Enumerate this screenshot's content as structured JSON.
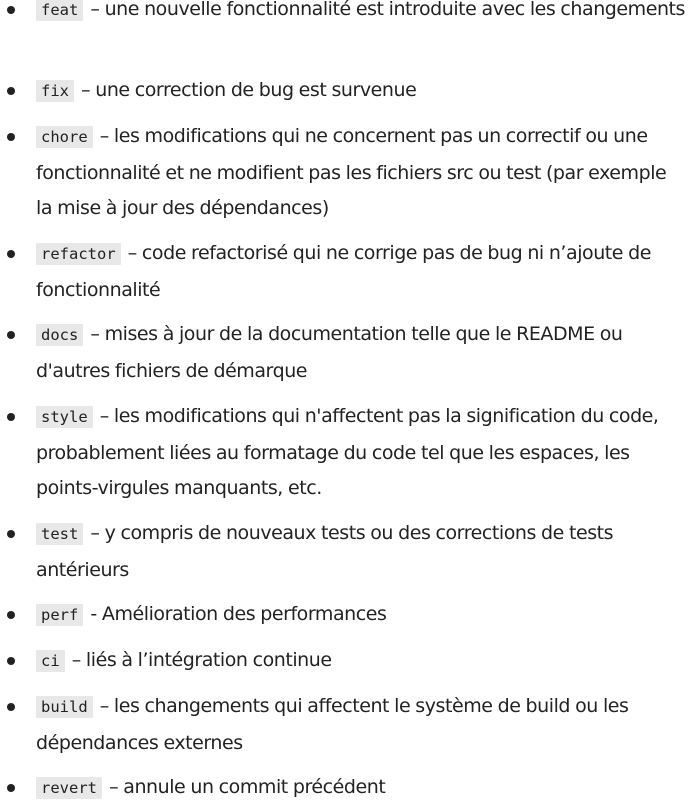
{
  "items": [
    {
      "type": "feat",
      "separator": "–",
      "description": "une nouvelle fonctionnalité est introduite avec les changements"
    },
    {
      "type": "fix",
      "separator": "–",
      "description": "une correction de bug est survenue"
    },
    {
      "type": "chore",
      "separator": "–",
      "description": "les modifications qui ne concernent pas un correctif ou une fonctionnalité et ne modifient pas les fichiers src ou test (par exemple la mise à jour des dépendances)"
    },
    {
      "type": "refactor",
      "separator": "–",
      "description": "code refactorisé qui ne corrige pas de bug ni n’ajoute de fonctionnalité"
    },
    {
      "type": "docs",
      "separator": "–",
      "description": "mises à jour de la documentation telle que le README ou d'autres fichiers de démarque"
    },
    {
      "type": "style",
      "separator": "–",
      "description": "les modifications qui n'affectent pas la signification du code, probablement liées au formatage du code tel que les espaces, les points-virgules manquants, etc."
    },
    {
      "type": "test",
      "separator": "–",
      "description": "y compris de nouveaux tests ou des corrections de tests antérieurs"
    },
    {
      "type": "perf",
      "separator": "-",
      "description": "Amélioration des performances"
    },
    {
      "type": "ci",
      "separator": "–",
      "description": "liés à l’intégration continue"
    },
    {
      "type": "build",
      "separator": "–",
      "description": "les changements qui affectent le système de build ou les dépendances externes"
    },
    {
      "type": "revert",
      "separator": "–",
      "description": "annule un commit précédent"
    }
  ]
}
